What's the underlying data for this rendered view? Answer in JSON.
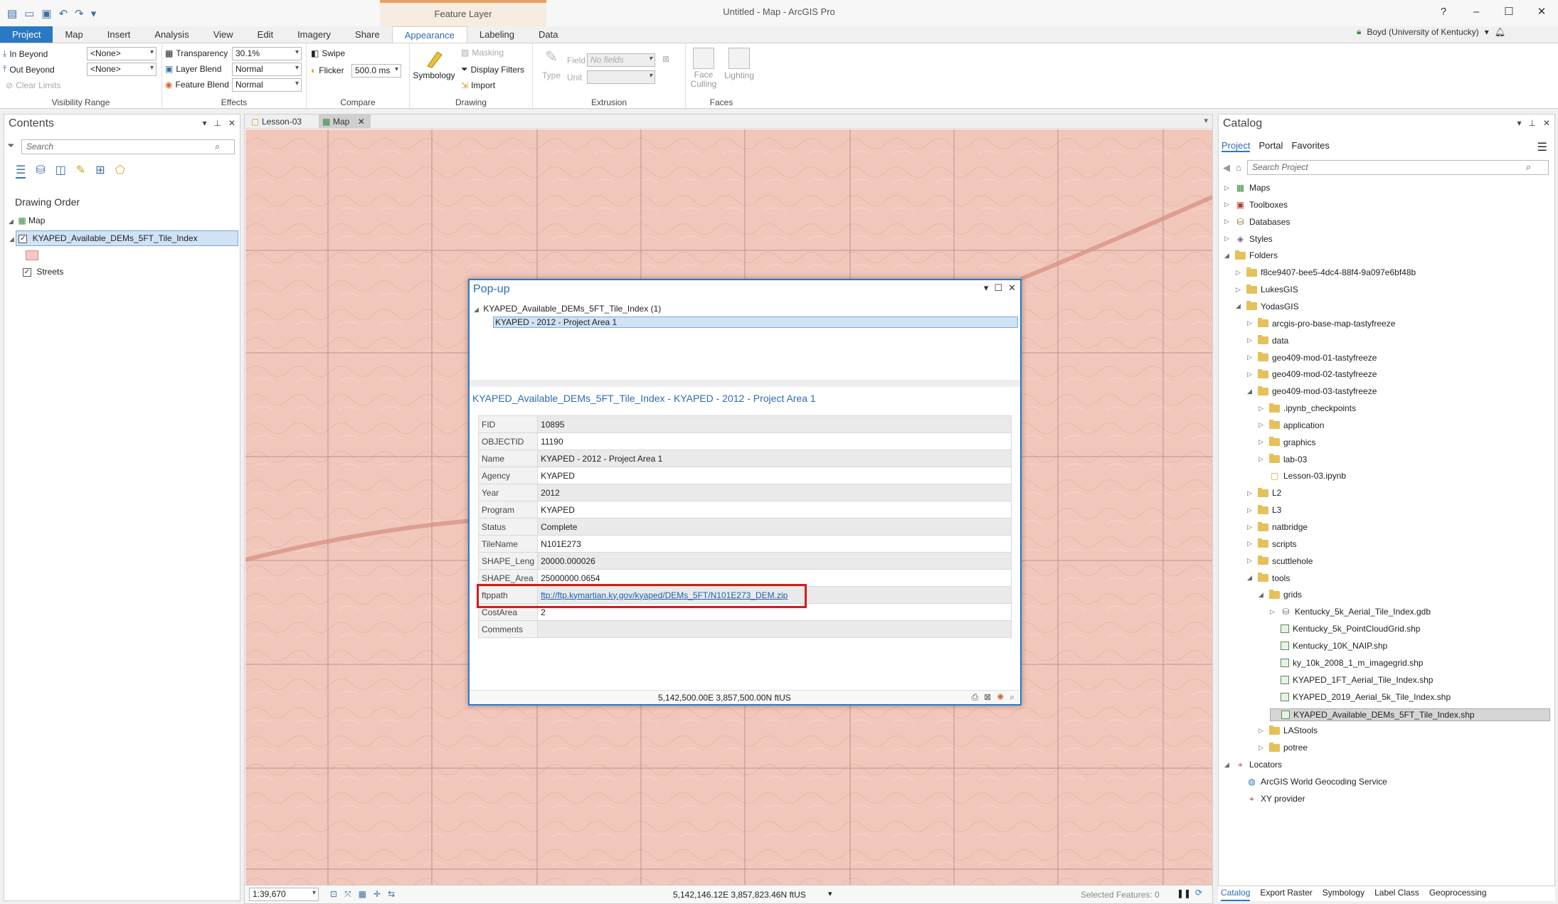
{
  "app": {
    "window_title": "Untitled - Map - ArcGIS Pro",
    "context_header": "Feature Layer",
    "user": "Boyd (University of Kentucky)",
    "window_controls": [
      "?",
      "–",
      "☐",
      "✕"
    ]
  },
  "ribbon_tabs": [
    "Project",
    "Map",
    "Insert",
    "Analysis",
    "View",
    "Edit",
    "Imagery",
    "Share",
    "Appearance",
    "Labeling",
    "Data"
  ],
  "ribbon": {
    "visibility": {
      "in_beyond": "In Beyond",
      "in_beyond_value": "<None>",
      "out_beyond": "Out Beyond",
      "out_beyond_value": "<None>",
      "clear_limits": "Clear Limits",
      "label": "Visibility Range"
    },
    "effects": {
      "transparency": "Transparency",
      "transparency_value": "30.1%",
      "layer_blend": "Layer Blend",
      "layer_blend_value": "Normal",
      "feature_blend": "Feature Blend",
      "feature_blend_value": "Normal",
      "label": "Effects"
    },
    "compare": {
      "swipe": "Swipe",
      "flicker": "Flicker",
      "flicker_value": "500.0  ms",
      "label": "Compare"
    },
    "drawing": {
      "symbology": "Symbology",
      "masking": "Masking",
      "display_filters": "Display Filters",
      "import": "Import",
      "label": "Drawing"
    },
    "extrusion": {
      "type": "Type",
      "field": "Field",
      "field_value": "No fields",
      "unit": "Unit",
      "label": "Extrusion"
    },
    "faces": {
      "face_culling": "Face Culling",
      "lighting": "Lighting",
      "label": "Faces"
    }
  },
  "contents": {
    "title": "Contents",
    "search_placeholder": "Search",
    "drawing_order": "Drawing Order",
    "map": "Map",
    "layer": "KYAPED_Available_DEMs_5FT_Tile_Index",
    "streets": "Streets"
  },
  "view_tabs": [
    "Lesson-03",
    "Map"
  ],
  "map_status": {
    "scale": "1:39,670",
    "coords": "5,142,146.12E 3,857,823.46N ftUS",
    "selected": "Selected Features: 0"
  },
  "popup": {
    "title": "Pop-up",
    "tree_layer": "KYAPED_Available_DEMs_5FT_Tile_Index  (1)",
    "tree_feature": "KYAPED - 2012 - Project Area 1",
    "heading": "KYAPED_Available_DEMs_5FT_Tile_Index - KYAPED - 2012 - Project Area 1",
    "fields": [
      {
        "k": "FID",
        "v": "10895"
      },
      {
        "k": "OBJECTID",
        "v": "11190"
      },
      {
        "k": "Name",
        "v": "KYAPED - 2012 - Project Area 1"
      },
      {
        "k": "Agency",
        "v": "KYAPED"
      },
      {
        "k": "Year",
        "v": "2012"
      },
      {
        "k": "Program",
        "v": "KYAPED"
      },
      {
        "k": "Status",
        "v": "Complete"
      },
      {
        "k": "TileName",
        "v": "N101E273"
      },
      {
        "k": "SHAPE_Leng",
        "v": "20000.000026"
      },
      {
        "k": "SHAPE_Area",
        "v": "25000000.0654"
      },
      {
        "k": "ftppath",
        "v": "ftp://ftp.kymartian.ky.gov/kyaped/DEMs_5FT/N101E273_DEM.zip"
      },
      {
        "k": "CostArea",
        "v": "2"
      },
      {
        "k": "Comments",
        "v": ""
      }
    ],
    "footer_coords": "5,142,500.00E 3,857,500.00N ftUS"
  },
  "catalog": {
    "title": "Catalog",
    "tabs": [
      "Project",
      "Portal",
      "Favorites"
    ],
    "search_placeholder": "Search Project",
    "items": [
      {
        "label": "Maps",
        "depth": 0,
        "tri": "▷",
        "icon": "map-icon"
      },
      {
        "label": "Toolboxes",
        "depth": 0,
        "tri": "▷",
        "icon": "toolbox-icon"
      },
      {
        "label": "Databases",
        "depth": 0,
        "tri": "▷",
        "icon": "database-icon"
      },
      {
        "label": "Styles",
        "depth": 0,
        "tri": "▷",
        "icon": "style-icon"
      },
      {
        "label": "Folders",
        "depth": 0,
        "tri": "◢",
        "icon": "folder-icon"
      },
      {
        "label": "f8ce9407-bee5-4dc4-88f4-9a097e6bf48b",
        "depth": 1,
        "tri": "▷",
        "icon": "folder-icon"
      },
      {
        "label": "LukesGIS",
        "depth": 1,
        "tri": "▷",
        "icon": "folder-icon"
      },
      {
        "label": "YodasGIS",
        "depth": 1,
        "tri": "◢",
        "icon": "folder-icon"
      },
      {
        "label": "arcgis-pro-base-map-tastyfreeze",
        "depth": 2,
        "tri": "▷",
        "icon": "folder-icon"
      },
      {
        "label": "data",
        "depth": 2,
        "tri": "▷",
        "icon": "folder-icon"
      },
      {
        "label": "geo409-mod-01-tastyfreeze",
        "depth": 2,
        "tri": "▷",
        "icon": "folder-icon"
      },
      {
        "label": "geo409-mod-02-tastyfreeze",
        "depth": 2,
        "tri": "▷",
        "icon": "folder-icon"
      },
      {
        "label": "geo409-mod-03-tastyfreeze",
        "depth": 2,
        "tri": "◢",
        "icon": "folder-icon"
      },
      {
        "label": ".ipynb_checkpoints",
        "depth": 3,
        "tri": "▷",
        "icon": "folder-icon"
      },
      {
        "label": "application",
        "depth": 3,
        "tri": "▷",
        "icon": "folder-icon"
      },
      {
        "label": "graphics",
        "depth": 3,
        "tri": "▷",
        "icon": "folder-icon"
      },
      {
        "label": "lab-03",
        "depth": 3,
        "tri": "▷",
        "icon": "folder-icon"
      },
      {
        "label": "Lesson-03.ipynb",
        "depth": 3,
        "tri": "",
        "icon": "notebook-icon"
      },
      {
        "label": "L2",
        "depth": 2,
        "tri": "▷",
        "icon": "folder-icon"
      },
      {
        "label": "L3",
        "depth": 2,
        "tri": "▷",
        "icon": "folder-icon"
      },
      {
        "label": "natbridge",
        "depth": 2,
        "tri": "▷",
        "icon": "folder-icon"
      },
      {
        "label": "scripts",
        "depth": 2,
        "tri": "▷",
        "icon": "folder-icon"
      },
      {
        "label": "scuttlehole",
        "depth": 2,
        "tri": "▷",
        "icon": "folder-icon"
      },
      {
        "label": "tools",
        "depth": 2,
        "tri": "◢",
        "icon": "folder-icon"
      },
      {
        "label": "grids",
        "depth": 3,
        "tri": "◢",
        "icon": "folder-icon"
      },
      {
        "label": "Kentucky_5k_Aerial_Tile_Index.gdb",
        "depth": 4,
        "tri": "▷",
        "icon": "geodatabase-icon"
      },
      {
        "label": "Kentucky_5k_PointCloudGrid.shp",
        "depth": 4,
        "tri": "",
        "icon": "shapefile-icon"
      },
      {
        "label": "Kentucky_10K_NAIP.shp",
        "depth": 4,
        "tri": "",
        "icon": "shapefile-icon"
      },
      {
        "label": "ky_10k_2008_1_m_imagegrid.shp",
        "depth": 4,
        "tri": "",
        "icon": "shapefile-icon"
      },
      {
        "label": "KYAPED_1FT_Aerial_Tile_Index.shp",
        "depth": 4,
        "tri": "",
        "icon": "shapefile-icon"
      },
      {
        "label": "KYAPED_2019_Aerial_5k_Tile_Index.shp",
        "depth": 4,
        "tri": "",
        "icon": "shapefile-icon"
      },
      {
        "label": "KYAPED_Available_DEMs_5FT_Tile_Index.shp",
        "depth": 4,
        "tri": "",
        "icon": "shapefile-icon",
        "selected": true
      },
      {
        "label": "LAStools",
        "depth": 3,
        "tri": "▷",
        "icon": "folder-icon"
      },
      {
        "label": "potree",
        "depth": 3,
        "tri": "▷",
        "icon": "folder-icon"
      },
      {
        "label": "Locators",
        "depth": 0,
        "tri": "◢",
        "icon": "locator-icon"
      },
      {
        "label": "ArcGIS World Geocoding Service",
        "depth": 1,
        "tri": "",
        "icon": "globe-icon"
      },
      {
        "label": "XY provider",
        "depth": 1,
        "tri": "",
        "icon": "locator-icon"
      }
    ],
    "bottom_tabs": [
      "Catalog",
      "Export Raster",
      "Symbology",
      "Label Class",
      "Geoprocessing"
    ]
  },
  "colors": {
    "accent": "#2b78c5",
    "map_fill": "#f2c7bb",
    "highlight_box": "#cc1f1f"
  }
}
